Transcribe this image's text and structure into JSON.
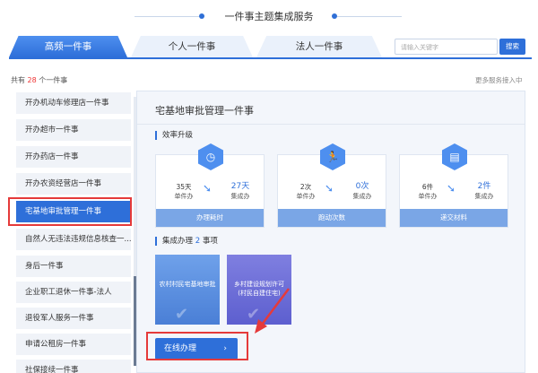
{
  "header": {
    "title": "一件事主题集成服务"
  },
  "tabs": [
    {
      "label": "高频一件事"
    },
    {
      "label": "个人一件事"
    },
    {
      "label": "法人一件事"
    }
  ],
  "search": {
    "placeholder": "请输入关键字",
    "button": "搜索"
  },
  "summary": {
    "prefix": "共有",
    "count": "28",
    "suffix": "个一件事",
    "more": "更多服务接入中"
  },
  "sidebar": {
    "items": [
      {
        "label": "开办机动车修理店一件事"
      },
      {
        "label": "开办超市一件事"
      },
      {
        "label": "开办药店一件事"
      },
      {
        "label": "开办农资经营店一件事"
      },
      {
        "label": "宅基地审批管理一件事"
      },
      {
        "label": "自然人无违法违规信息核查一..."
      },
      {
        "label": "身后一件事"
      },
      {
        "label": "企业职工退休一件事-法人"
      },
      {
        "label": "退役军人服务一件事"
      },
      {
        "label": "申请公租房一件事"
      },
      {
        "label": "社保接续一件事"
      }
    ]
  },
  "main": {
    "title": "宅基地审批管理一件事",
    "efficiency_label": "效率升级",
    "cards": [
      {
        "icon": "clock-icon",
        "left_value": "35天",
        "left_sub": "单件办",
        "right_value": "27天",
        "right_sub": "集成办",
        "footer": "办理耗时"
      },
      {
        "icon": "runner-icon",
        "left_value": "2次",
        "left_sub": "单件办",
        "right_value": "0次",
        "right_sub": "集成办",
        "footer": "跑动次数"
      },
      {
        "icon": "document-icon",
        "left_value": "6件",
        "left_sub": "单件办",
        "right_value": "2件",
        "right_sub": "集成办",
        "footer": "递交材料"
      }
    ],
    "integrated_label_prefix": "集成办理",
    "integrated_count": "2",
    "integrated_label_suffix": "事项",
    "tiles": [
      {
        "label": "农村村民宅基地审批"
      },
      {
        "label": "乡村建设规划许可(村民自建住宅)"
      }
    ],
    "online_button": "在线办理"
  }
}
